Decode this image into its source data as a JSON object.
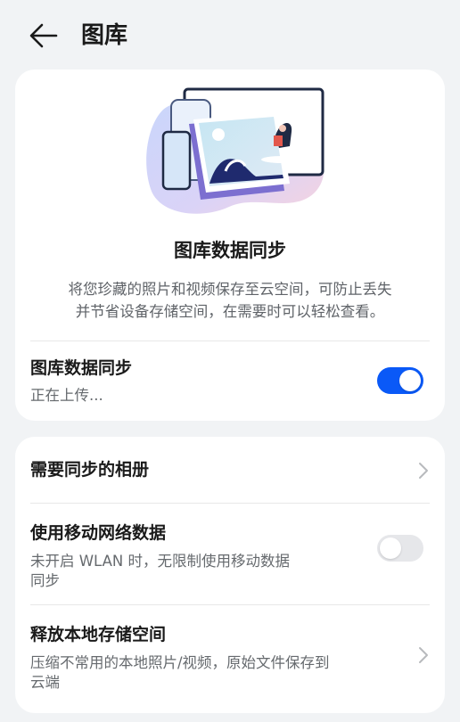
{
  "header": {
    "title": "图库"
  },
  "sync_card": {
    "title": "图库数据同步",
    "description_lines": [
      "将您珍藏的照片和视频保存至云空间，可防止丢失",
      "并节省设备存储空间，在需要时可以轻松查看。"
    ],
    "setting_title": "图库数据同步",
    "setting_status": "正在上传...",
    "toggle_on": true,
    "accent_color": "#0a59f7"
  },
  "settings": {
    "albums": {
      "title": "需要同步的相册"
    },
    "mobile_data": {
      "title": "使用移动网络数据",
      "subtitle_lines": [
        "未开启 WLAN 时，无限制使用移动数据",
        "同步"
      ],
      "toggle_on": false
    },
    "free_space": {
      "title": "释放本地存储空间",
      "subtitle_lines": [
        "压缩不常用的本地照片/视频，原始文件保存到",
        "云端"
      ]
    }
  }
}
